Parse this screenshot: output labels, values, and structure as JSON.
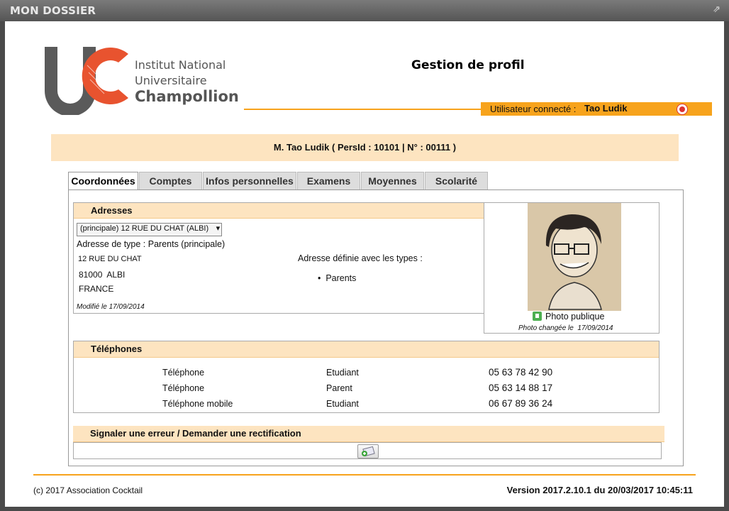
{
  "window": {
    "title": "MON DOSSIER"
  },
  "institution": {
    "line1": "Institut National",
    "line2": "Universitaire",
    "line3": "Champollion"
  },
  "header": {
    "title": "Gestion de profil"
  },
  "user": {
    "label": "Utilisateur connecté :",
    "name": "Tao Ludik"
  },
  "identity": "M. Tao Ludik ( PersId : 10101 | N° : 00111 )",
  "tabs": [
    "Coordonnées",
    "Comptes",
    "Infos personnelles",
    "Examens",
    "Moyennes",
    "Scolarité"
  ],
  "addresses": {
    "title": "Adresses",
    "select_value": "(principale) 12 RUE DU CHAT (ALBI)",
    "type_line": "Adresse de type : Parents (principale)",
    "street": "12 RUE DU CHAT",
    "city": "81000  ALBI",
    "country": "FRANCE",
    "modified": "Modifié le 17/09/2014",
    "types_title": "Adresse définie avec les types :",
    "types": [
      "Parents"
    ]
  },
  "photo": {
    "label": "Photo publique",
    "changed": "Photo changée le  17/09/2014"
  },
  "phones": {
    "title": "Téléphones",
    "rows": [
      {
        "type": "Téléphone",
        "owner": "Etudiant",
        "number": "05 63 78 42 90"
      },
      {
        "type": "Téléphone",
        "owner": "Parent",
        "number": "05 63 14 88 17"
      },
      {
        "type": "Téléphone mobile",
        "owner": "Etudiant",
        "number": "06 67 89 36 24"
      }
    ]
  },
  "report": {
    "title": "Signaler une erreur / Demander une rectification"
  },
  "footer": {
    "copyright": "(c) 2017 Association Cocktail",
    "version": "Version 2017.2.10.1 du 20/03/2017 10:45:11"
  },
  "colors": {
    "accent": "#f7a31c",
    "section_bg": "#fde4c0",
    "logo_red": "#e8532f",
    "logo_grey": "#5a5a5a"
  }
}
